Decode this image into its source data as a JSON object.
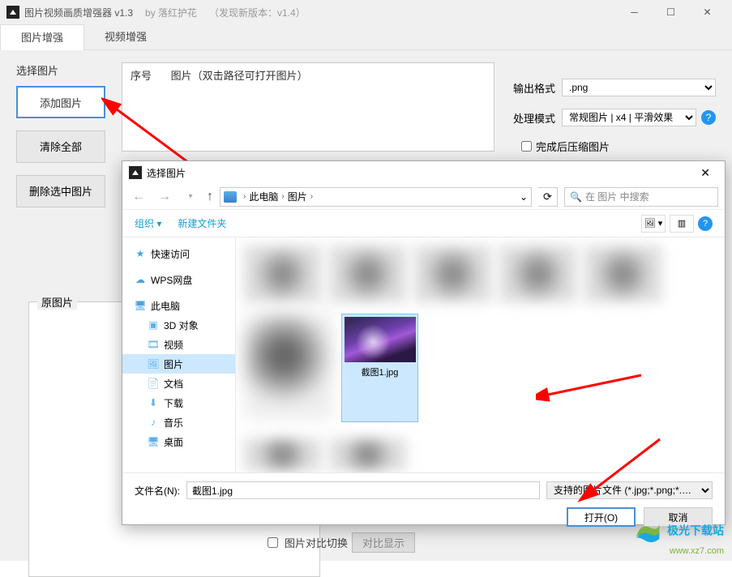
{
  "window": {
    "title": "图片视频画质增强器 v1.3",
    "author": "by 落红护花",
    "newVersion": "（发现新版本：v1.4）"
  },
  "tabs": {
    "image": "图片增强",
    "video": "视频增强"
  },
  "leftPanel": {
    "label": "选择图片",
    "add": "添加图片",
    "clear": "清除全部",
    "delete": "删除选中图片"
  },
  "list": {
    "colIndex": "序号",
    "colPath": "图片（双击路径可打开图片）"
  },
  "rightPanel": {
    "outputFormatLabel": "输出格式",
    "outputFormat": ".png",
    "modeLabel": "处理模式",
    "mode": "常规图片 | x4 | 平滑效果",
    "compressLabel": "完成后压缩图片"
  },
  "preview": {
    "label": "原图片"
  },
  "dialog": {
    "title": "选择图片",
    "breadcrumb": {
      "root": "此电脑",
      "folder": "图片"
    },
    "searchPlaceholder": "在 图片 中搜索",
    "organize": "组织",
    "newFolder": "新建文件夹",
    "sidebar": {
      "quick": "快速访问",
      "wps": "WPS网盘",
      "pc": "此电脑",
      "obj3d": "3D 对象",
      "video": "视频",
      "pictures": "图片",
      "docs": "文档",
      "downloads": "下载",
      "music": "音乐",
      "desktop": "桌面"
    },
    "selectedFile": "截图1.jpg",
    "fileNameLabel": "文件名(N):",
    "fileName": "截图1.jpg",
    "fileType": "支持的图片文件 (*.jpg;*.png;*.…",
    "openBtn": "打开(O)",
    "cancelBtn": "取消"
  },
  "bottom": {
    "compareLabel": "图片对比切换",
    "compareBtn": "对比显示"
  },
  "watermark": {
    "brand": "极光下载站",
    "url": "www.xz7.com"
  }
}
